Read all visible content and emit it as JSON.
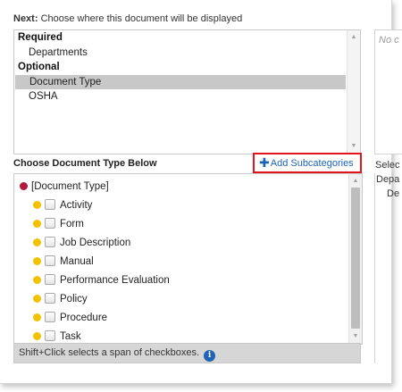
{
  "instruction": {
    "prefix": "Next:",
    "text": "Choose where this document will be displayed"
  },
  "display_list": {
    "groups": [
      {
        "label": "Required",
        "items": [
          "Departments"
        ]
      },
      {
        "label": "Optional",
        "items": [
          "Document Type",
          "OSHA"
        ]
      }
    ],
    "selected": "Document Type"
  },
  "right_panel": {
    "empty_text": "No c",
    "heading": "Selec",
    "sub1": "Depa",
    "sub2": "De"
  },
  "section": {
    "title": "Choose Document Type Below",
    "add_subcategories": "Add Subcategories"
  },
  "tree": {
    "root": "[Document Type]",
    "items": [
      "Activity",
      "Form",
      "Job Description",
      "Manual",
      "Performance Evaluation",
      "Policy",
      "Procedure",
      "Task"
    ]
  },
  "footer": {
    "hint": "Shift+Click selects a span of checkboxes."
  },
  "colors": {
    "accent": "#1e63b4",
    "highlight_border": "#e3141b",
    "root_dot": "#b3173e",
    "item_dot": "#f2c200",
    "selection": "#c8c8c8"
  },
  "icons": {
    "add": "plus-icon",
    "info": "info-icon"
  }
}
